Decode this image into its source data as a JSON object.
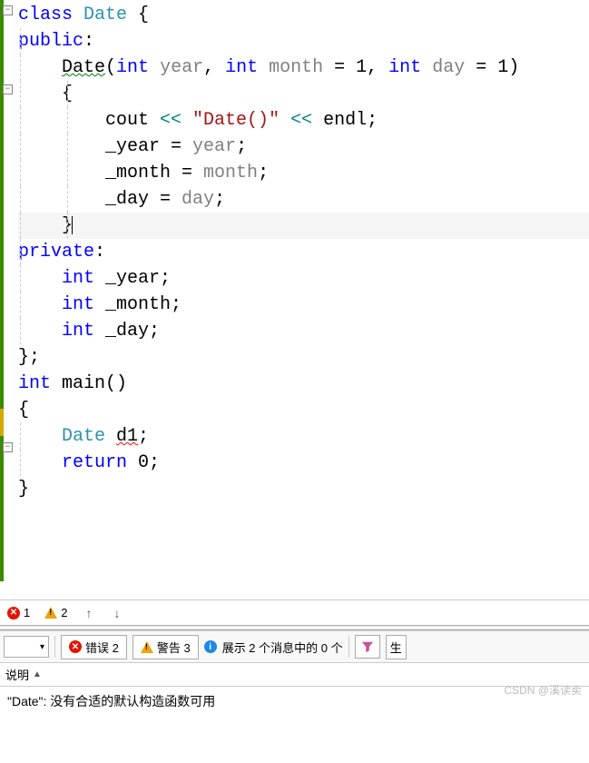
{
  "code": {
    "line1": {
      "kw": "class",
      "cls": " Date ",
      "brace": "{"
    },
    "line2": {
      "kw": "public",
      "colon": ":"
    },
    "line3": {
      "fn": "Date",
      "paren1": "(",
      "t1": "int",
      "p1": " year",
      "c1": ", ",
      "t2": "int",
      "p2": " month ",
      "eq1": "=",
      "v1": " 1",
      "c2": ", ",
      "t3": "int",
      "p3": " day ",
      "eq2": "=",
      "v2": " 1",
      "paren2": ")"
    },
    "line4": {
      "brace": "{"
    },
    "line5": {
      "cout": "cout ",
      "op1": "<<",
      "str": " \"Date()\" ",
      "op2": "<<",
      "endl": " endl",
      "semi": ";"
    },
    "line6": {
      "v": "_year ",
      "eq": "=",
      "r": " year",
      "semi": ";"
    },
    "line7": {
      "v": "_month ",
      "eq": "=",
      "r": " month",
      "semi": ";"
    },
    "line8": {
      "v": "_day ",
      "eq": "=",
      "r": " day",
      "semi": ";"
    },
    "line9": {
      "brace": "}"
    },
    "line10": {
      "kw": "private",
      "colon": ":"
    },
    "line11": {
      "t": "int",
      "v": " _year",
      "semi": ";"
    },
    "line12": {
      "t": "int",
      "v": " _month",
      "semi": ";"
    },
    "line13": {
      "t": "int",
      "v": " _day",
      "semi": ";"
    },
    "line14": {
      "brace": "}",
      "semi": ";"
    },
    "line15": {
      "t": "int",
      "fn": " main",
      "parens": "()"
    },
    "line16": {
      "brace": "{"
    },
    "line17": {
      "cls": "Date ",
      "v": "d1",
      "semi": ";"
    },
    "line18": {
      "kw": "return",
      "v": " 0",
      "semi": ";"
    },
    "line19": {
      "brace": "}"
    }
  },
  "summary": {
    "error_count": "1",
    "warn_count": "2"
  },
  "filter": {
    "errors": "错误 2",
    "warnings": "警告 3",
    "messages": "展示 2 个消息中的 0 个",
    "build_btn": "生"
  },
  "columns": {
    "description": "说明"
  },
  "error_message": "\"Date\": 没有合适的默认构造函数可用",
  "watermark": "CSDN @溪读卖"
}
